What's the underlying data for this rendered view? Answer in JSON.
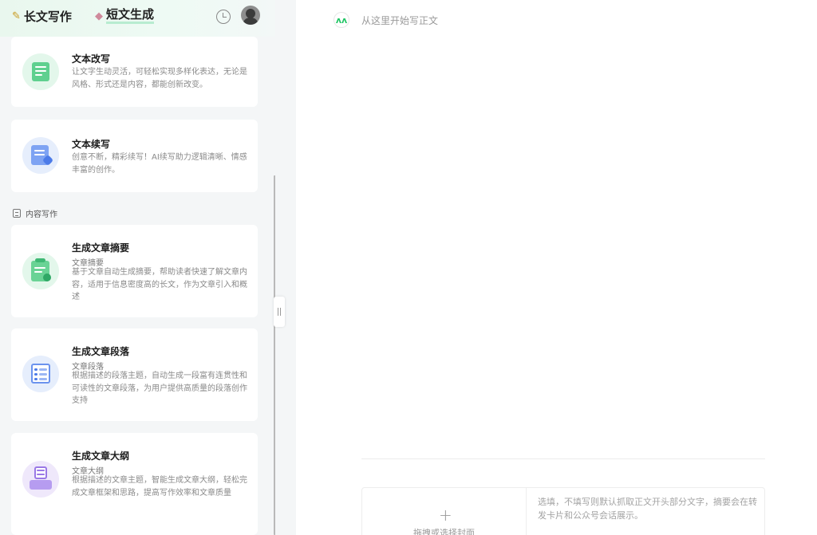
{
  "header": {
    "tabs": [
      {
        "label": "长文写作",
        "icon": "pencil-icon"
      },
      {
        "label": "短文生成",
        "icon": "eraser-icon"
      }
    ],
    "history_icon": "history-clock-icon",
    "avatar_icon": "user-avatar"
  },
  "cards_top": [
    {
      "title": "文本改写",
      "description": "让文字生动灵活，可轻松实现多样化表达，无论是风格、形式还是内容，都能创新改变。",
      "icon": "rewrite-doc-icon"
    },
    {
      "title": "文本续写",
      "description": "创意不断，精彩续写！AI续写助力逻辑清晰、情感丰富的创作。",
      "icon": "continue-writing-icon"
    }
  ],
  "section": {
    "label": "内容写作",
    "icon": "document-icon"
  },
  "cards_content": [
    {
      "title": "生成文章摘要",
      "subtitle": "文章摘要",
      "description": "基于文章自动生成摘要，帮助读者快速了解文章内容，适用于信息密度高的长文，作为文章引入和概述",
      "icon": "summary-clipboard-icon"
    },
    {
      "title": "生成文章段落",
      "subtitle": "文章段落",
      "description": "根据描述的段落主题，自动生成一段富有连贯性和可读性的文章段落，为用户提供高质量的段落创作支持",
      "icon": "paragraph-checklist-icon"
    },
    {
      "title": "生成文章大纲",
      "subtitle": "文章大纲",
      "description": "根据描述的文章主题，智能生成文章大纲，轻松完成文章框架和思路，提高写作效率和文章质量",
      "icon": "outline-box-icon"
    }
  ],
  "editor": {
    "body_placeholder": "从这里开始写正文",
    "generate_icon": "ai-generate-icon",
    "cover_plus": "+",
    "cover_label": "拖拽或选择封面",
    "summary_placeholder": "选填，不填写则默认抓取正文开头部分文字，摘要会在转发卡片和公众号会话展示。"
  },
  "colors": {
    "accent_green": "#20c564",
    "panel_bg": "#f4f6f7",
    "header_gradient_start": "#e9f7ee"
  }
}
